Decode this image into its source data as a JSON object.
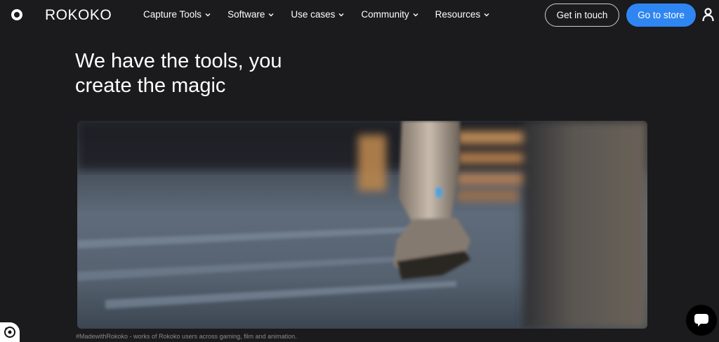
{
  "brand": {
    "name": "ROKOKO"
  },
  "nav": {
    "items": [
      {
        "label": "Capture Tools"
      },
      {
        "label": "Software"
      },
      {
        "label": "Use cases"
      },
      {
        "label": "Community"
      },
      {
        "label": "Resources"
      }
    ],
    "get_in_touch_label": "Get in touch",
    "go_to_store_label": "Go to store"
  },
  "hero": {
    "title_line1": "We have the tools, you",
    "title_line2": "create the magic"
  },
  "video": {
    "caption": "#MadewithRokoko - works of Rokoko users across gaming, film and animation."
  },
  "colors": {
    "background": "#1b1a1c",
    "accent": "#2f86f2",
    "text": "#ffffff",
    "caption": "#8a8a8e"
  },
  "icons": {
    "logo": "ring-logo-icon",
    "chevron": "chevron-down-icon",
    "user": "user-icon",
    "chat": "chat-icon",
    "cookie": "cookie-settings-icon"
  }
}
